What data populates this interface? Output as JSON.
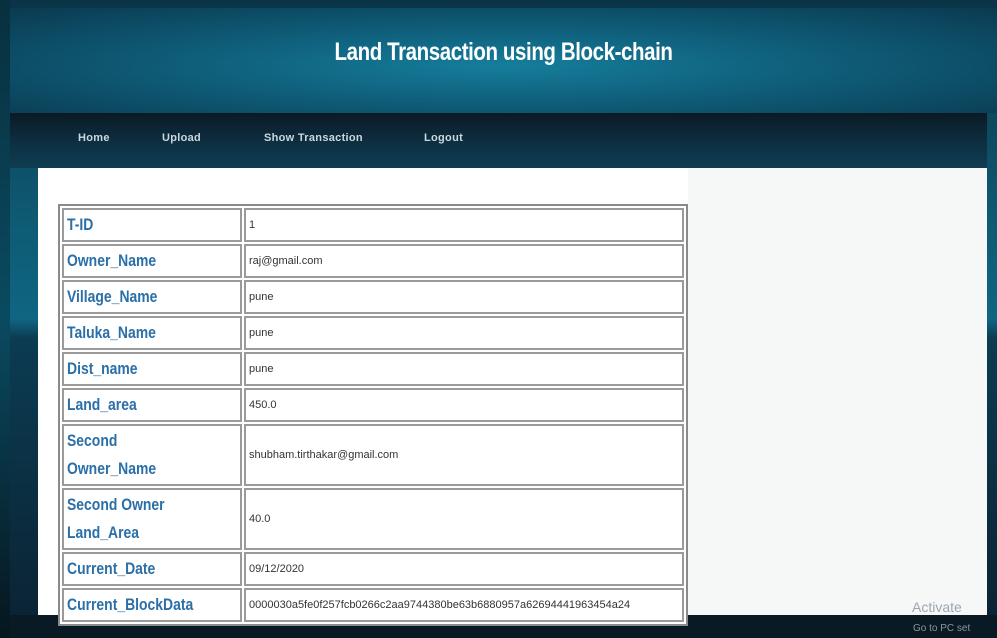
{
  "header": {
    "title": "Land Transaction using Block-chain"
  },
  "nav": {
    "items": [
      {
        "label": "Home"
      },
      {
        "label": "Upload"
      },
      {
        "label": "Show Transaction"
      },
      {
        "label": "Logout"
      }
    ]
  },
  "transaction": {
    "rows": [
      {
        "label": "T-ID",
        "value": "1"
      },
      {
        "label": "Owner_Name",
        "value": "raj@gmail.com"
      },
      {
        "label": "Village_Name",
        "value": "pune"
      },
      {
        "label": "Taluka_Name",
        "value": "pune"
      },
      {
        "label": "Dist_name",
        "value": "pune"
      },
      {
        "label": "Land_area",
        "value": "450.0"
      },
      {
        "label": "Second Owner_Name",
        "value": "shubham.tirthakar@gmail.com"
      },
      {
        "label": "Second Owner Land_Area",
        "value": "40.0"
      },
      {
        "label": "Current_Date",
        "value": "09/12/2020"
      },
      {
        "label": "Current_BlockData",
        "value": "0000030a5fe0f257fcb0266c2aa9744380be63b6880957a62694441963454a24"
      }
    ]
  },
  "watermark": {
    "title": "Activate",
    "subtitle": "Go to PC set"
  },
  "colors": {
    "label": "#2a6fa8",
    "header": "#0f5e7a",
    "nav": "#0e2f42"
  }
}
